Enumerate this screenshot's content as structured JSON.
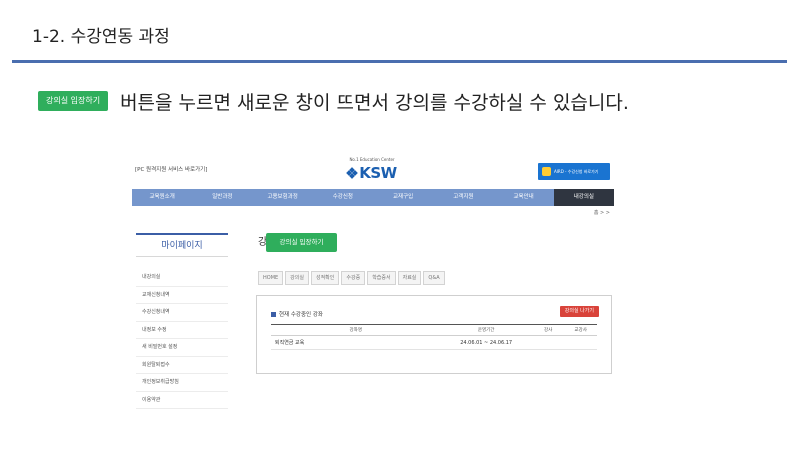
{
  "slide": {
    "title": "1-2. 수강연동 과정",
    "accent_color": "#4a6eaf",
    "chip_label": "강의실 입장하기",
    "instruction": "버튼을 누르면 새로운 창이 뜨면서 강의를 수강하실 수 있습니다."
  },
  "site": {
    "quick_link": "[PC 원격지원 서비스 바로가기]",
    "logo_tag": "No.1 Education Center",
    "logo_text": "KSW",
    "promo_text": "AIRD - 수강신청 바로가기",
    "nav": [
      {
        "label": "교육원소개"
      },
      {
        "label": "일반과정"
      },
      {
        "label": "고용보험과정"
      },
      {
        "label": "수강신청"
      },
      {
        "label": "교재구입"
      },
      {
        "label": "고객지원"
      },
      {
        "label": "교육안내"
      },
      {
        "label": "내강의실"
      }
    ],
    "breadcrumb": "홈 > >",
    "sidebar": {
      "title": "마이페이지",
      "items": [
        {
          "label": "내강의실"
        },
        {
          "label": "교재신청내역"
        },
        {
          "label": "수강신청내역"
        },
        {
          "label": "내정보 수정"
        },
        {
          "label": "새 비밀번호 설정"
        },
        {
          "label": "회원탈퇴접수"
        },
        {
          "label": "개인정보취급방침"
        },
        {
          "label": "이용약관"
        }
      ]
    },
    "content": {
      "title": "강의실",
      "tabs": [
        {
          "label": "HOME"
        },
        {
          "label": "강의실"
        },
        {
          "label": "성적확인"
        },
        {
          "label": "수강증"
        },
        {
          "label": "학습증서"
        },
        {
          "label": "자료실"
        },
        {
          "label": "Q&A"
        }
      ],
      "box_title": "현재 수강중인 강좌",
      "exit_label": "강의실 나가기",
      "table": {
        "headers": [
          "강좌명",
          "운영기간",
          "강사",
          "교강사"
        ],
        "rows": [
          [
            "퇴직연금 교육",
            "24.06.01 ~ 24.06.17",
            "",
            ""
          ]
        ]
      },
      "enter_label": "강의실 입장하기"
    },
    "colors": {
      "nav_bg": "#7596cc",
      "nav_active": "#2f3540",
      "green": "#2fae5c",
      "red": "#d9433a",
      "brand_blue": "#1b5fb0"
    }
  }
}
